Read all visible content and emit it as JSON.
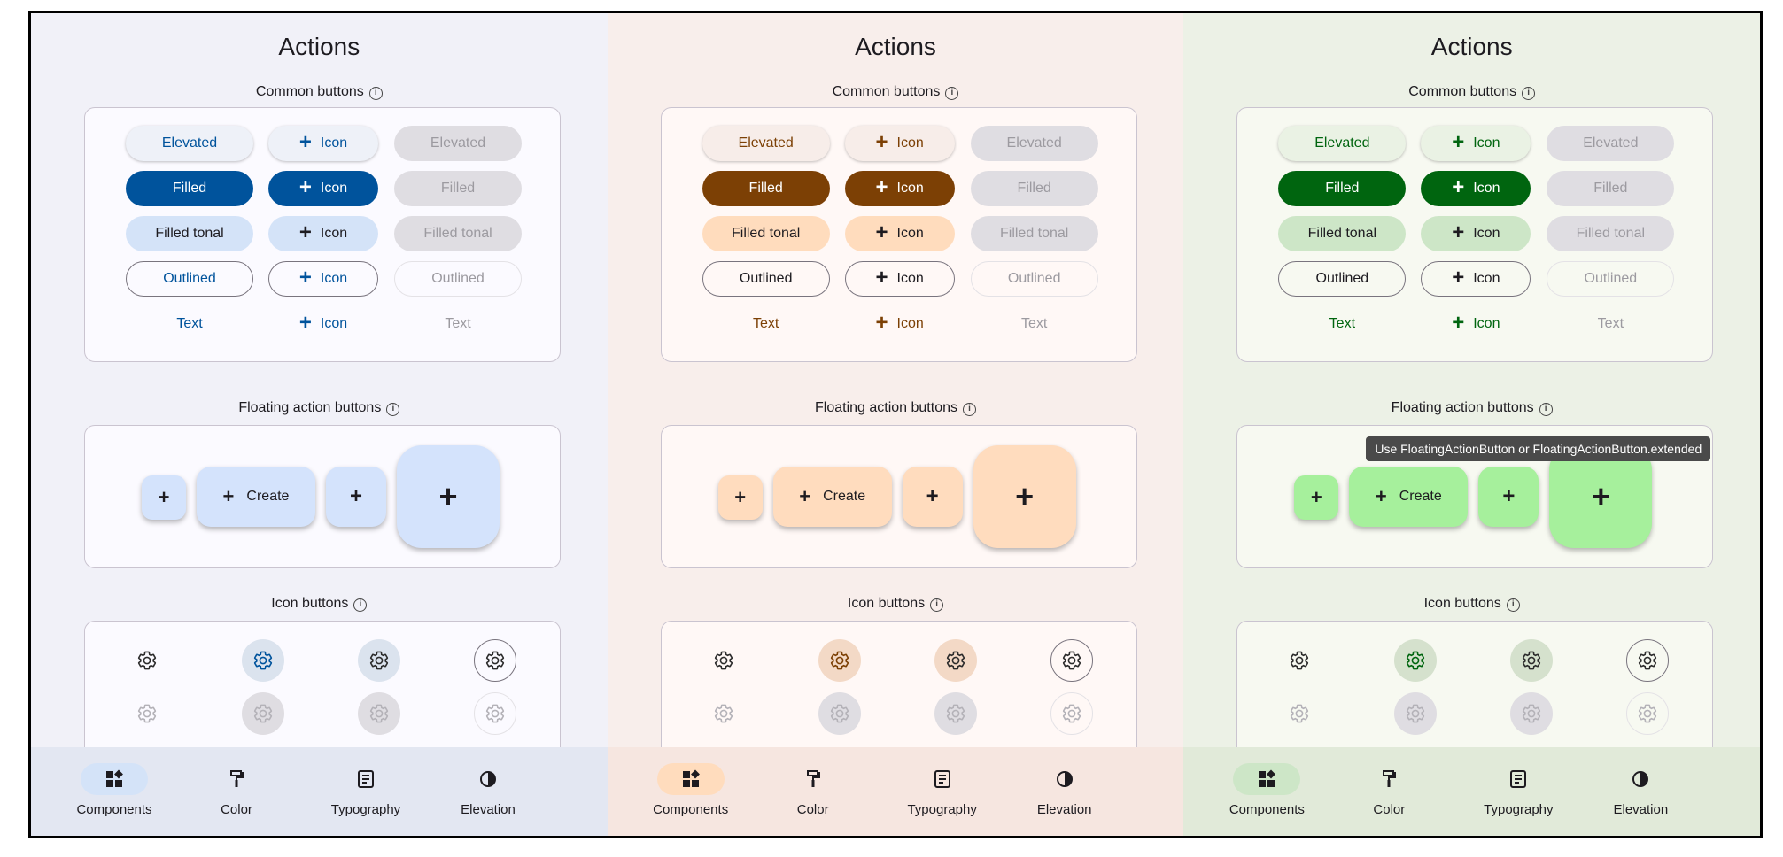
{
  "panels": [
    {
      "title": "Actions",
      "bg": "#f1f1f8",
      "card_bg": "#fbfaff",
      "nav_bg": "#e3e7f2",
      "primary": "#00539c",
      "tonal": "#d4e3f8",
      "elevated_bg": "#eef1f8",
      "fab_bg": "#d4e3fc",
      "icon_sel_bg": "#dbe3ee",
      "tooltip": null
    },
    {
      "title": "Actions",
      "bg": "#f8eeeb",
      "card_bg": "#fff8f6",
      "nav_bg": "#f6e6e0",
      "primary": "#7c4005",
      "tonal": "#ffdcbd",
      "elevated_bg": "#f7ede9",
      "fab_bg": "#ffdcbe",
      "icon_sel_bg": "#f3d9c6",
      "tooltip": null
    },
    {
      "title": "Actions",
      "bg": "#ecf1e6",
      "card_bg": "#f7f9f1",
      "nav_bg": "#e1ead9",
      "primary": "#00650f",
      "tonal": "#cde6c7",
      "elevated_bg": "#eaf2e4",
      "fab_bg": "#a6f09c",
      "icon_sel_bg": "#d5e1cd",
      "tooltip": "Use FloatingActionButton or FloatingActionButton.extended"
    }
  ],
  "sections": {
    "common_buttons": "Common buttons",
    "fab": "Floating action buttons",
    "icon_buttons": "Icon buttons",
    "info_glyph": "i"
  },
  "buttons": {
    "elevated": "Elevated",
    "filled": "Filled",
    "filled_tonal": "Filled tonal",
    "outlined": "Outlined",
    "text": "Text",
    "icon": "Icon",
    "plus": "+"
  },
  "fab": {
    "create": "Create",
    "plus": "+"
  },
  "icons": {
    "gear": "settings-gear-icon"
  },
  "nav": [
    "Components",
    "Color",
    "Typography",
    "Elevation"
  ],
  "colors": {
    "disabled_bg": "#dfdde2",
    "disabled_text": "#9c9aa0",
    "outline": "#79747e",
    "disabled_outline": "#e4e2e6",
    "gear_dark": "#2c2c2c",
    "gear_disabled": "#b4b2b8"
  }
}
